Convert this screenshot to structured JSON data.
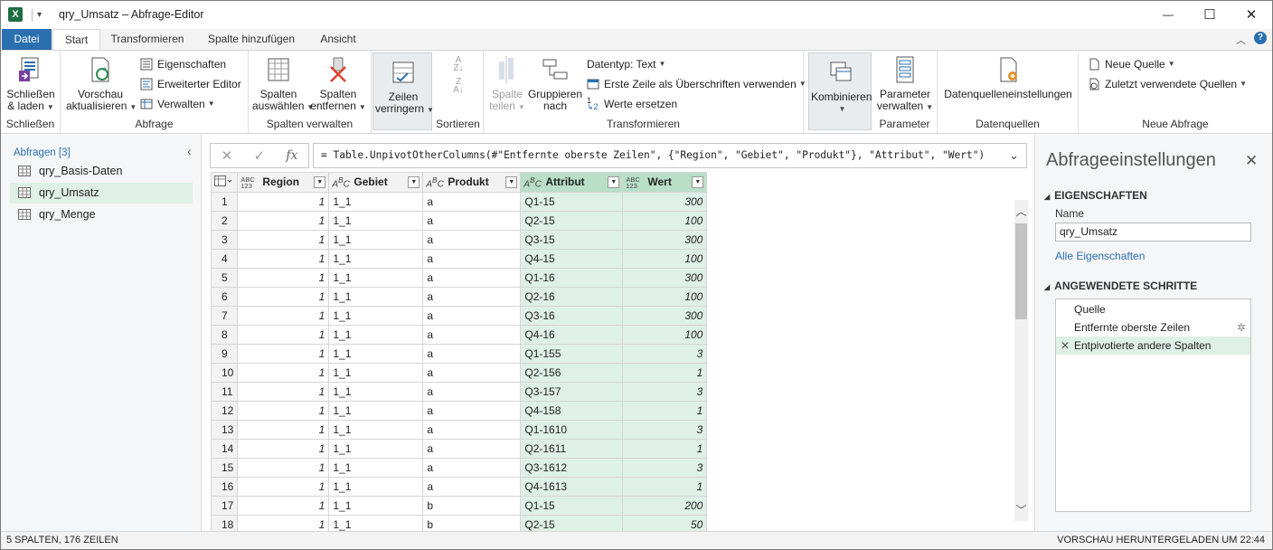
{
  "window": {
    "title": "qry_Umsatz – Abfrage-Editor",
    "app_icon_letter": "X",
    "controls": {
      "minimize": "—",
      "maximize": "☐",
      "close": "✕"
    }
  },
  "tabs": [
    "Datei",
    "Start",
    "Transformieren",
    "Spalte hinzufügen",
    "Ansicht"
  ],
  "ribbon": {
    "groups": {
      "schliessen": {
        "label": "Schließen",
        "btn_line1": "Schließen",
        "btn_line2": "& laden"
      },
      "abfrage": {
        "label": "Abfrage",
        "vorschau1": "Vorschau",
        "vorschau2": "aktualisieren",
        "eigenschaften": "Eigenschaften",
        "erweiterter_editor": "Erweiterter Editor",
        "verwalten": "Verwalten"
      },
      "spalten": {
        "label": "Spalten verwalten",
        "auswaehlen1": "Spalten",
        "auswaehlen2": "auswählen",
        "entfernen1": "Spalten",
        "entfernen2": "entfernen"
      },
      "zeilen": {
        "label": "",
        "btn1": "Zeilen",
        "btn2": "verringern"
      },
      "sortieren": {
        "label": "Sortieren"
      },
      "transformieren": {
        "label": "Transformieren",
        "teilen1": "Spalte",
        "teilen2": "teilen",
        "gruppieren1": "Gruppieren",
        "gruppieren2": "nach",
        "datentyp": "Datentyp: Text",
        "erste_zeile": "Erste Zeile als Überschriften verwenden",
        "werte_ersetzen": "Werte ersetzen"
      },
      "kombinieren": {
        "label": "",
        "btn": "Kombinieren"
      },
      "parameter": {
        "label": "Parameter",
        "btn1": "Parameter",
        "btn2": "verwalten"
      },
      "datenquellen": {
        "label": "Datenquellen",
        "btn": "Datenquelleneinstellungen"
      },
      "neue_abfrage": {
        "label": "Neue Abfrage",
        "neue_quelle": "Neue Quelle",
        "zuletzt": "Zuletzt verwendete Quellen"
      }
    }
  },
  "queries": {
    "header": "Abfragen [3]",
    "items": [
      "qry_Basis-Daten",
      "qry_Umsatz",
      "qry_Menge"
    ],
    "selected_index": 1
  },
  "formula": {
    "text": "= Table.UnpivotOtherColumns(#\"Entfernte oberste Zeilen\", {\"Region\", \"Gebiet\", \"Produkt\"}, \"Attribut\", \"Wert\")"
  },
  "grid": {
    "columns": [
      {
        "name": "Region",
        "type": "ABC\n123"
      },
      {
        "name": "Gebiet",
        "type": "ABC"
      },
      {
        "name": "Produkt",
        "type": "ABC"
      },
      {
        "name": "Attribut",
        "type": "ABC"
      },
      {
        "name": "Wert",
        "type": "ABC\n123"
      }
    ],
    "highlighted_columns": [
      3,
      4
    ],
    "rows": [
      [
        "1",
        "1",
        "1_1",
        "a",
        "Q1-15",
        "300"
      ],
      [
        "2",
        "1",
        "1_1",
        "a",
        "Q2-15",
        "100"
      ],
      [
        "3",
        "1",
        "1_1",
        "a",
        "Q3-15",
        "300"
      ],
      [
        "4",
        "1",
        "1_1",
        "a",
        "Q4-15",
        "100"
      ],
      [
        "5",
        "1",
        "1_1",
        "a",
        "Q1-16",
        "300"
      ],
      [
        "6",
        "1",
        "1_1",
        "a",
        "Q2-16",
        "100"
      ],
      [
        "7",
        "1",
        "1_1",
        "a",
        "Q3-16",
        "300"
      ],
      [
        "8",
        "1",
        "1_1",
        "a",
        "Q4-16",
        "100"
      ],
      [
        "9",
        "1",
        "1_1",
        "a",
        "Q1-155",
        "3"
      ],
      [
        "10",
        "1",
        "1_1",
        "a",
        "Q2-156",
        "1"
      ],
      [
        "11",
        "1",
        "1_1",
        "a",
        "Q3-157",
        "3"
      ],
      [
        "12",
        "1",
        "1_1",
        "a",
        "Q4-158",
        "1"
      ],
      [
        "13",
        "1",
        "1_1",
        "a",
        "Q1-1610",
        "3"
      ],
      [
        "14",
        "1",
        "1_1",
        "a",
        "Q2-1611",
        "1"
      ],
      [
        "15",
        "1",
        "1_1",
        "a",
        "Q3-1612",
        "3"
      ],
      [
        "16",
        "1",
        "1_1",
        "a",
        "Q4-1613",
        "1"
      ],
      [
        "17",
        "1",
        "1_1",
        "b",
        "Q1-15",
        "200"
      ],
      [
        "18",
        "1",
        "1_1",
        "b",
        "Q2-15",
        "50"
      ]
    ]
  },
  "settings": {
    "title": "Abfrageeinstellungen",
    "properties_header": "EIGENSCHAFTEN",
    "name_label": "Name",
    "name_value": "qry_Umsatz",
    "all_properties": "Alle Eigenschaften",
    "steps_header": "ANGEWENDETE SCHRITTE",
    "steps": [
      "Quelle",
      "Entfernte oberste Zeilen",
      "Entpivotierte andere Spalten"
    ],
    "selected_step": 2
  },
  "status": {
    "left": "5 SPALTEN, 176 ZEILEN",
    "right": "VORSCHAU HERUNTERGELADEN UM 22:44"
  }
}
